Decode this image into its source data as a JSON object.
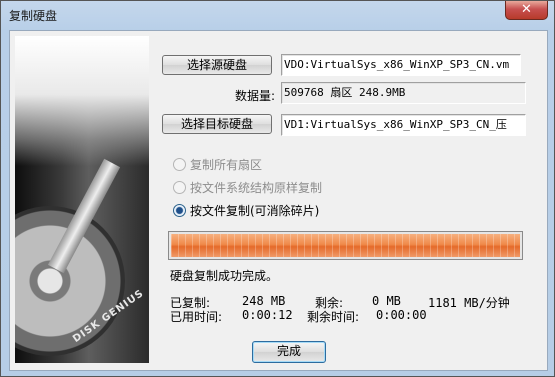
{
  "window": {
    "title": "复制硬盘",
    "close_symbol": "✕"
  },
  "sidebar": {
    "brand_text": "DISK GENIUS"
  },
  "source": {
    "button_label": "选择源硬盘",
    "disk_value": "VDO:VirtualSys_x86_WinXP_SP3_CN.vm",
    "size_label": "数据量:",
    "size_value": "509768 扇区  248.9MB"
  },
  "target": {
    "button_label": "选择目标硬盘",
    "disk_value": "VD1:VirtualSys_x86_WinXP_SP3_CN_压"
  },
  "options": [
    {
      "label": "复制所有扇区",
      "checked": false,
      "enabled": false
    },
    {
      "label": "按文件系统结构原样复制",
      "checked": false,
      "enabled": false
    },
    {
      "label": "按文件复制(可消除碎片)",
      "checked": true,
      "enabled": true
    }
  ],
  "progress": {
    "percent": 100,
    "status_text": "硬盘复制成功完成。"
  },
  "stats": {
    "copied_label": "已复制:",
    "copied_value": "248 MB",
    "remaining_label": "剩余:",
    "remaining_value": "0 MB",
    "speed_value": "1181 MB/分钟",
    "elapsed_label": "已用时间:",
    "elapsed_value": "0:00:12",
    "time_left_label": "剩余时间:",
    "time_left_value": "0:00:00"
  },
  "done_button_label": "完成",
  "colors": {
    "accent": "#f08a4b",
    "window_frame": "#b8cfe8"
  }
}
